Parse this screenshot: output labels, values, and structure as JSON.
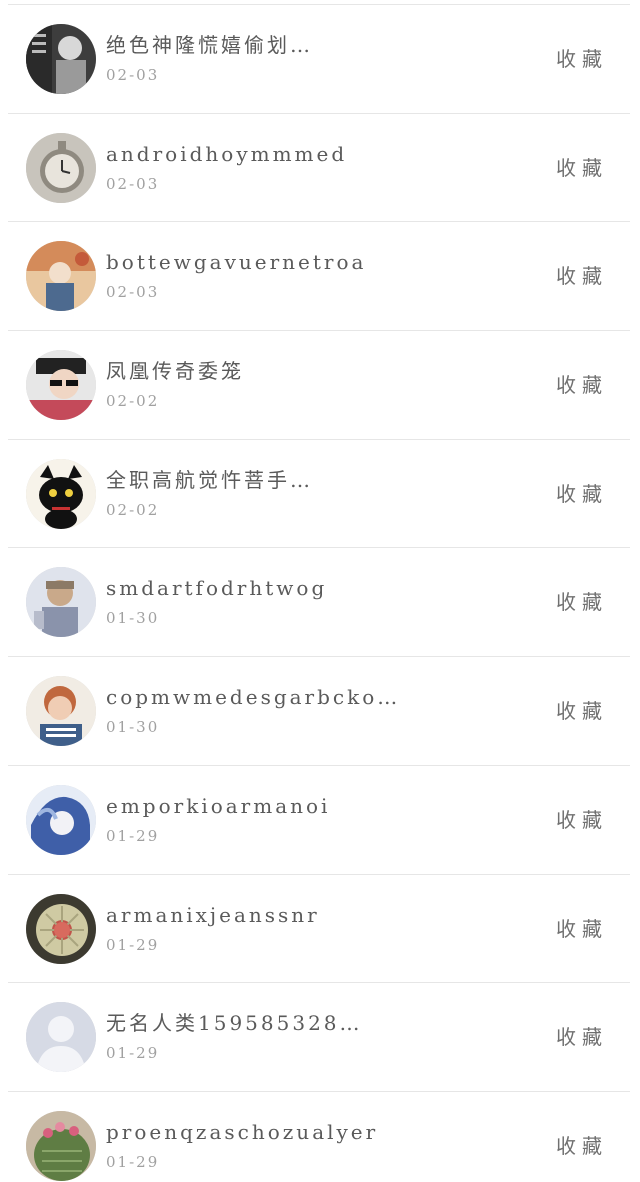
{
  "favorite_label": "收藏",
  "items": [
    {
      "name": "绝色神隆慌嬉偷划…",
      "date": "02-03",
      "avatar_color": "#4a4a4a"
    },
    {
      "name": "androidhoymmmed",
      "date": "02-03",
      "avatar_color": "#b7b1a6"
    },
    {
      "name": "bottewgavuernetroa",
      "date": "02-03",
      "avatar_color": "#d9a67a"
    },
    {
      "name": "凤凰传奇委笼",
      "date": "02-02",
      "avatar_color": "#7d8289"
    },
    {
      "name": "全职高航觉忤菩手…",
      "date": "02-02",
      "avatar_color": "#1b1b1b"
    },
    {
      "name": "smdartfodrhtwog",
      "date": "01-30",
      "avatar_color": "#a7aab5"
    },
    {
      "name": "copmwmedesgarbcko…",
      "date": "01-30",
      "avatar_color": "#c97a52"
    },
    {
      "name": "emporkioarmanoi",
      "date": "01-29",
      "avatar_color": "#5b77b5"
    },
    {
      "name": "armanixjeanssnr",
      "date": "01-29",
      "avatar_color": "#c6c29a"
    },
    {
      "name": "无名人类159585328…",
      "date": "01-29",
      "avatar_color": "#d7dae3"
    },
    {
      "name": "proenqzaschozualyer",
      "date": "01-29",
      "avatar_color": "#6f8a4f"
    }
  ]
}
